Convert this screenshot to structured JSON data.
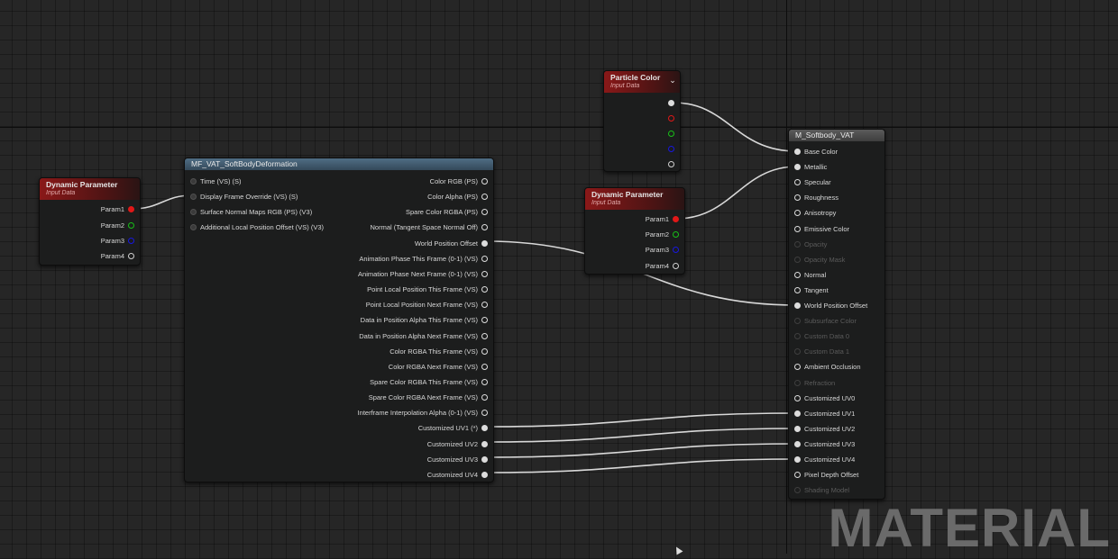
{
  "watermark": "MATERIAL",
  "colors": {
    "wire": "#d8d8d8",
    "red_pin": "#e01818",
    "green_pin": "#18c018",
    "blue_pin": "#1818e0",
    "grid_bg": "#262626"
  },
  "nodes": {
    "dyn1": {
      "title": "Dynamic Parameter",
      "subtitle": "Input Data",
      "outputs": [
        "Param1",
        "Param2",
        "Param3",
        "Param4"
      ]
    },
    "mf": {
      "title": "MF_VAT_SoftBodyDeformation",
      "inputs": [
        "Time (VS) (S)",
        "Display Frame Override (VS) (S)",
        "Surface Normal Maps RGB (PS) (V3)",
        "Additional Local Position Offset (VS) (V3)"
      ],
      "outputs": [
        "Color RGB (PS)",
        "Color Alpha (PS)",
        "Spare Color RGBA (PS)",
        "Normal (Tangent Space Normal Off)",
        "World Position Offset",
        "Animation Phase This Frame (0-1) (VS)",
        "Animation Phase Next Frame (0-1) (VS)",
        "Point Local Position This Frame (VS)",
        "Point Local Position Next Frame (VS)",
        "Data in Position Alpha This Frame (VS)",
        "Data in Position Alpha Next Frame (VS)",
        "Color RGBA This Frame (VS)",
        "Color RGBA Next Frame (VS)",
        "Spare Color RGBA This Frame (VS)",
        "Spare Color RGBA Next Frame (VS)",
        "Interframe Interpolation Alpha (0-1) (VS)",
        "Customized UV1 (*)",
        "Customized UV2",
        "Customized UV3",
        "Customized UV4"
      ]
    },
    "particle": {
      "title": "Particle Color",
      "subtitle": "Input Data"
    },
    "dyn2": {
      "title": "Dynamic Parameter",
      "subtitle": "Input Data",
      "outputs": [
        "Param1",
        "Param2",
        "Param3",
        "Param4"
      ]
    },
    "material": {
      "title": "M_Softbody_VAT",
      "inputs": [
        "Base Color",
        "Metallic",
        "Specular",
        "Roughness",
        "Anisotropy",
        "Emissive Color",
        "Opacity",
        "Opacity Mask",
        "Normal",
        "Tangent",
        "World Position Offset",
        "Subsurface Color",
        "Custom Data 0",
        "Custom Data 1",
        "Ambient Occlusion",
        "Refraction",
        "Customized UV0",
        "Customized UV1",
        "Customized UV2",
        "Customized UV3",
        "Customized UV4",
        "Pixel Depth Offset",
        "Shading Model"
      ],
      "disabled_inputs": [
        "Opacity",
        "Opacity Mask",
        "Subsurface Color",
        "Custom Data 0",
        "Custom Data 1",
        "Refraction",
        "Shading Model"
      ]
    }
  }
}
